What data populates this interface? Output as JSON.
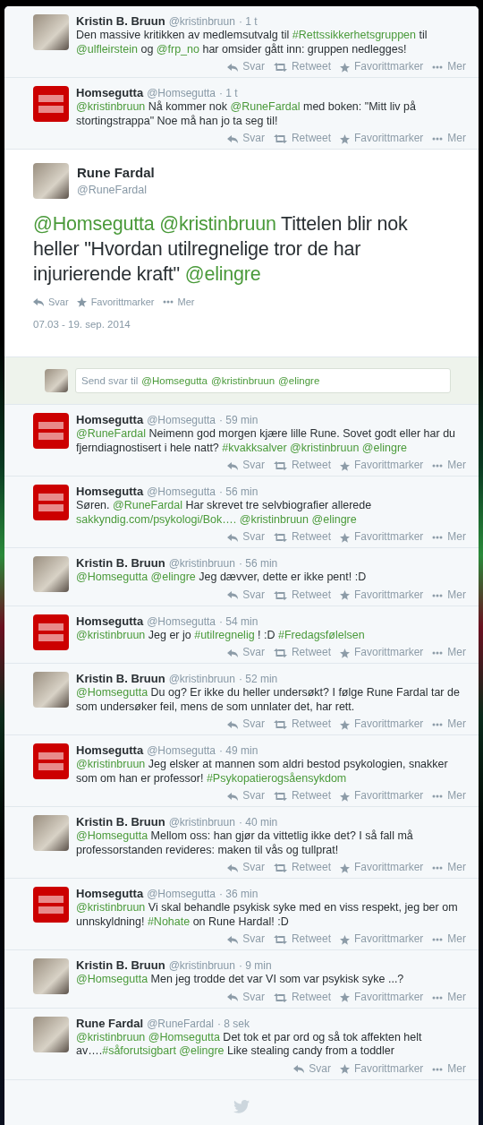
{
  "tweets_before": [
    {
      "kind": "photo",
      "name": "Kristin B. Bruun",
      "handle": "@kristinbruun",
      "time": "· 1 t",
      "parts": [
        {
          "text": "Den massive kritikken av medlemsutvalg til ",
          "link": false
        },
        {
          "text": "#Rettssikkerhetsgruppen",
          "link": true
        },
        {
          "text": " til ",
          "link": false
        },
        {
          "text": "@ulfleirstein",
          "link": true
        },
        {
          "text": "  og ",
          "link": false
        },
        {
          "text": "@frp_no",
          "link": true
        },
        {
          "text": "  har omsider gått inn: gruppen nedlegges!",
          "link": false
        }
      ],
      "actions": [
        {
          "kind": "reply",
          "label": "Svar"
        },
        {
          "kind": "retweet",
          "label": "Retweet"
        },
        {
          "kind": "favorite",
          "label": "Favorittmarker"
        },
        {
          "kind": "more",
          "label": "Mer"
        }
      ]
    },
    {
      "kind": "logo",
      "name": "Homsegutta",
      "handle": "@Homsegutta",
      "time": "· 1 t",
      "parts": [
        {
          "text": "@kristinbruun",
          "link": true
        },
        {
          "text": " Nå kommer nok ",
          "link": false
        },
        {
          "text": "@RuneFardal",
          "link": true
        },
        {
          "text": " med boken: \"Mitt liv på stortingstrappa\" Noe må han jo ta seg til!",
          "link": false
        }
      ],
      "actions": [
        {
          "kind": "reply",
          "label": "Svar"
        },
        {
          "kind": "retweet",
          "label": "Retweet"
        },
        {
          "kind": "favorite",
          "label": "Favorittmarker"
        },
        {
          "kind": "more",
          "label": "Mer"
        }
      ]
    }
  ],
  "focused": {
    "kind": "photo",
    "name": "Rune Fardal",
    "handle": "@RuneFardal",
    "parts": [
      {
        "text": "@Homsegutta ",
        "link": true
      },
      {
        "text": "@kristinbruun",
        "link": true
      },
      {
        "text": " Tittelen blir nok heller \"Hvordan utilregnelige tror de har injurierende kraft\" ",
        "link": false
      },
      {
        "text": "@elingre",
        "link": true
      }
    ],
    "actions": [
      {
        "kind": "reply",
        "label": "Svar"
      },
      {
        "kind": "favorite",
        "label": "Favorittmarker"
      },
      {
        "kind": "more",
        "label": "Mer"
      }
    ],
    "date": "07.03 - 19. sep. 2014"
  },
  "reply_box": {
    "kind": "photo",
    "prompt": "Send svar til",
    "mentions": [
      "@Homsegutta",
      "@kristinbruun",
      "@elingre"
    ]
  },
  "replies": [
    {
      "kind": "logo",
      "name": "Homsegutta",
      "handle": "@Homsegutta",
      "time": "· 59 min",
      "parts": [
        {
          "text": "@RuneFardal",
          "link": true
        },
        {
          "text": " Neimenn god morgen kjære lille Rune. Sovet godt eller har du fjerndiagnostisert i hele natt? ",
          "link": false
        },
        {
          "text": "#kvakksalver ",
          "link": true
        },
        {
          "text": "@kristinbruun ",
          "link": true
        },
        {
          "text": "@elingre",
          "link": true
        }
      ],
      "actions": [
        {
          "kind": "reply",
          "label": "Svar"
        },
        {
          "kind": "retweet",
          "label": "Retweet"
        },
        {
          "kind": "favorite",
          "label": "Favorittmarker"
        },
        {
          "kind": "more",
          "label": "Mer"
        }
      ]
    },
    {
      "kind": "logo",
      "name": "Homsegutta",
      "handle": "@Homsegutta",
      "time": "· 56 min",
      "parts": [
        {
          "text": "Søren. ",
          "link": false
        },
        {
          "text": "@RuneFardal",
          "link": true
        },
        {
          "text": " Har skrevet tre selvbiografier allerede ",
          "link": false
        },
        {
          "text": "sakkyndig.com/psykologi/Bok…. ",
          "link": true
        },
        {
          "text": "@kristinbruun ",
          "link": true
        },
        {
          "text": "@elingre",
          "link": true
        }
      ],
      "actions": [
        {
          "kind": "reply",
          "label": "Svar"
        },
        {
          "kind": "retweet",
          "label": "Retweet"
        },
        {
          "kind": "favorite",
          "label": "Favorittmarker"
        },
        {
          "kind": "more",
          "label": "Mer"
        }
      ]
    },
    {
      "kind": "photo",
      "name": "Kristin B. Bruun",
      "handle": "@kristinbruun",
      "time": "· 56 min",
      "parts": [
        {
          "text": "@Homsegutta ",
          "link": true
        },
        {
          "text": "@elingre",
          "link": true
        },
        {
          "text": " Jeg dævver, dette er ikke pent!  :D",
          "link": false
        }
      ],
      "actions": [
        {
          "kind": "reply",
          "label": "Svar"
        },
        {
          "kind": "retweet",
          "label": "Retweet"
        },
        {
          "kind": "favorite",
          "label": "Favorittmarker"
        },
        {
          "kind": "more",
          "label": "Mer"
        }
      ]
    },
    {
      "kind": "logo",
      "name": "Homsegutta",
      "handle": "@Homsegutta",
      "time": "· 54 min",
      "parts": [
        {
          "text": "@kristinbruun",
          "link": true
        },
        {
          "text": " Jeg er jo ",
          "link": false
        },
        {
          "text": "#utilregnelig",
          "link": true
        },
        {
          "text": " ! :D ",
          "link": false
        },
        {
          "text": "#Fredagsfølelsen",
          "link": true
        }
      ],
      "actions": [
        {
          "kind": "reply",
          "label": "Svar"
        },
        {
          "kind": "retweet",
          "label": "Retweet"
        },
        {
          "kind": "favorite",
          "label": "Favorittmarker"
        },
        {
          "kind": "more",
          "label": "Mer"
        }
      ]
    },
    {
      "kind": "photo",
      "name": "Kristin B. Bruun",
      "handle": "@kristinbruun",
      "time": "· 52 min",
      "parts": [
        {
          "text": "@Homsegutta",
          "link": true
        },
        {
          "text": " Du og? Er ikke du heller undersøkt? I følge Rune Fardal tar de som undersøker feil, mens de som unnlater det,  har rett.",
          "link": false
        }
      ],
      "actions": [
        {
          "kind": "reply",
          "label": "Svar"
        },
        {
          "kind": "retweet",
          "label": "Retweet"
        },
        {
          "kind": "favorite",
          "label": "Favorittmarker"
        },
        {
          "kind": "more",
          "label": "Mer"
        }
      ]
    },
    {
      "kind": "logo",
      "name": "Homsegutta",
      "handle": "@Homsegutta",
      "time": "· 49 min",
      "parts": [
        {
          "text": "@kristinbruun",
          "link": true
        },
        {
          "text": " Jeg elsker at mannen som aldri bestod psykologien, snakker som om han er professor! ",
          "link": false
        },
        {
          "text": "#Psykopatierogsåensykdom",
          "link": true
        }
      ],
      "actions": [
        {
          "kind": "reply",
          "label": "Svar"
        },
        {
          "kind": "retweet",
          "label": "Retweet"
        },
        {
          "kind": "favorite",
          "label": "Favorittmarker"
        },
        {
          "kind": "more",
          "label": "Mer"
        }
      ]
    },
    {
      "kind": "photo",
      "name": "Kristin B. Bruun",
      "handle": "@kristinbruun",
      "time": "· 40 min",
      "parts": [
        {
          "text": "@Homsegutta",
          "link": true
        },
        {
          "text": " Mellom oss: han gjør da vittetlig ikke det?  I så fall må professorstanden revideres: maken til vås og tullprat!",
          "link": false
        }
      ],
      "actions": [
        {
          "kind": "reply",
          "label": "Svar"
        },
        {
          "kind": "retweet",
          "label": "Retweet"
        },
        {
          "kind": "favorite",
          "label": "Favorittmarker"
        },
        {
          "kind": "more",
          "label": "Mer"
        }
      ]
    },
    {
      "kind": "logo",
      "name": "Homsegutta",
      "handle": "@Homsegutta",
      "time": "· 36 min",
      "parts": [
        {
          "text": "@kristinbruun",
          "link": true
        },
        {
          "text": " Vi skal behandle psykisk syke med en viss respekt, jeg ber om unnskyldning! ",
          "link": false
        },
        {
          "text": "#Nohate",
          "link": true
        },
        {
          "text": " on Rune Hardal! :D",
          "link": false
        }
      ],
      "actions": [
        {
          "kind": "reply",
          "label": "Svar"
        },
        {
          "kind": "retweet",
          "label": "Retweet"
        },
        {
          "kind": "favorite",
          "label": "Favorittmarker"
        },
        {
          "kind": "more",
          "label": "Mer"
        }
      ]
    },
    {
      "kind": "photo",
      "name": "Kristin B. Bruun",
      "handle": "@kristinbruun",
      "time": "· 9 min",
      "parts": [
        {
          "text": "@Homsegutta",
          "link": true
        },
        {
          "text": " Men jeg trodde det var VI som var psykisk syke ...?",
          "link": false
        }
      ],
      "actions": [
        {
          "kind": "reply",
          "label": "Svar"
        },
        {
          "kind": "retweet",
          "label": "Retweet"
        },
        {
          "kind": "favorite",
          "label": "Favorittmarker"
        },
        {
          "kind": "more",
          "label": "Mer"
        }
      ]
    },
    {
      "kind": "photo",
      "name": "Rune Fardal",
      "handle": "@RuneFardal",
      "time": "· 8 sek",
      "parts": [
        {
          "text": "@kristinbruun ",
          "link": true
        },
        {
          "text": "@Homsegutta",
          "link": true
        },
        {
          "text": " Det tok  et par ord og så tok affekten helt av….",
          "link": false
        },
        {
          "text": "#såforutsigbart ",
          "link": true
        },
        {
          "text": "@elingre",
          "link": true
        },
        {
          "text": " Like stealing candy from a toddler",
          "link": false
        }
      ],
      "actions": [
        {
          "kind": "reply",
          "label": "Svar"
        },
        {
          "kind": "favorite",
          "label": "Favorittmarker"
        },
        {
          "kind": "more",
          "label": "Mer"
        }
      ]
    }
  ]
}
